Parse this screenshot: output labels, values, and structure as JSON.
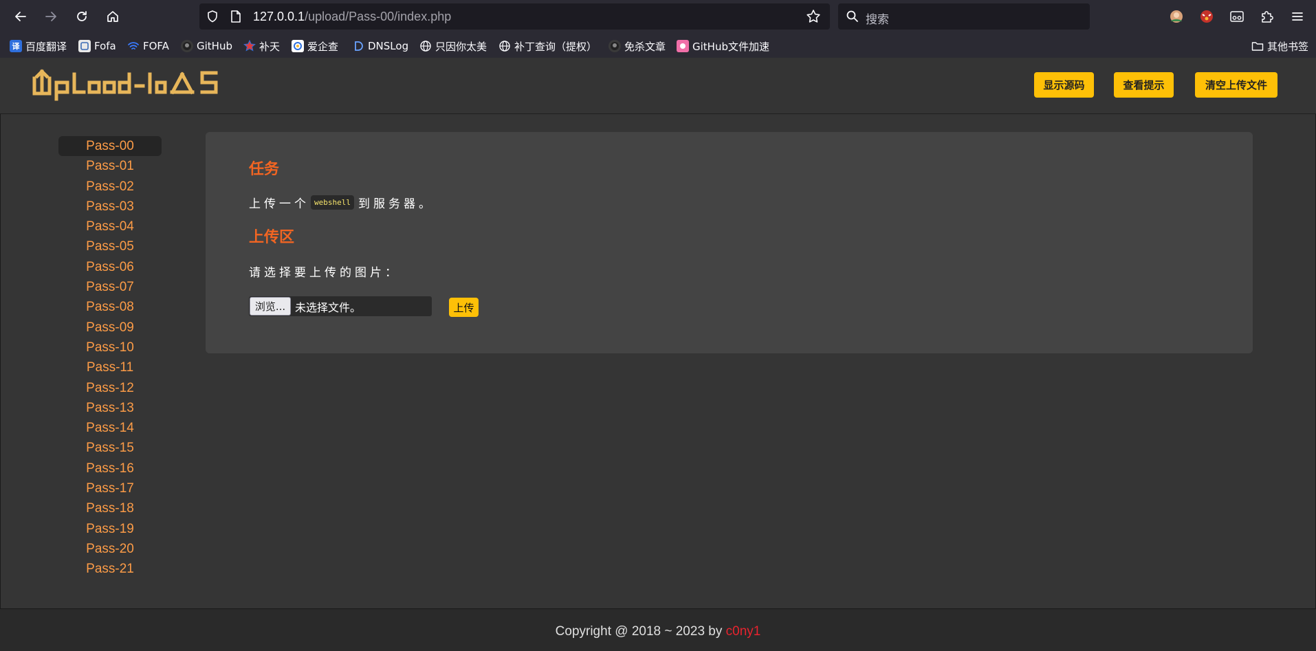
{
  "browser": {
    "url_host": "127.0.0.1",
    "url_path": "/upload/Pass-00/index.php",
    "search_placeholder": "搜索",
    "bookmarks": [
      "百度翻译",
      "Fofa",
      "FOFA",
      "GitHub",
      "补天",
      "爱企查",
      "DNSLog",
      "只因你太美",
      "补丁查询（提权）",
      "免杀文章",
      "GitHub文件加速"
    ],
    "other_bookmarks": "其他书签",
    "bookmark_badge": "译"
  },
  "header": {
    "buttons": {
      "show_source": "显示源码",
      "view_hint": "查看提示",
      "clear_uploads": "清空上传文件"
    }
  },
  "sidebar": {
    "items": [
      "Pass-00",
      "Pass-01",
      "Pass-02",
      "Pass-03",
      "Pass-04",
      "Pass-05",
      "Pass-06",
      "Pass-07",
      "Pass-08",
      "Pass-09",
      "Pass-10",
      "Pass-11",
      "Pass-12",
      "Pass-13",
      "Pass-14",
      "Pass-15",
      "Pass-16",
      "Pass-17",
      "Pass-18",
      "Pass-19",
      "Pass-20",
      "Pass-21"
    ],
    "active": "Pass-00"
  },
  "content": {
    "task_heading": "任务",
    "task_prefix": "上传一个",
    "task_code": "webshell",
    "task_suffix": "到服务器。",
    "upload_heading": "上传区",
    "choose_label": "请选择要上传的图片：",
    "browse_label": "浏览...",
    "no_file_label": "未选择文件。",
    "submit_label": "上传"
  },
  "footer": {
    "text": "Copyright @ 2018 ~ 2023 by ",
    "author": "c0ny1"
  },
  "colors": {
    "accent_yellow": "#fec007",
    "heading_orange": "#f26522",
    "link_orange": "#fd9c47",
    "author_red": "#e8232e"
  }
}
